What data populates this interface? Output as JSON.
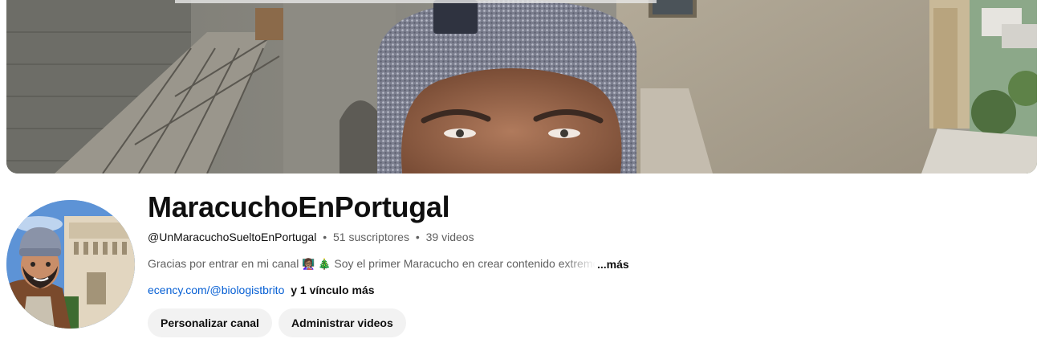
{
  "channel": {
    "name": "MaracuchoEnPortugal",
    "handle": "@UnMaracuchoSueltoEnPortugal",
    "subscribers": "51 suscriptores",
    "videos": "39 videos",
    "separator": "•",
    "description": "Gracias por entrar en mi canal",
    "description_emoji_1": "👩🏽‍🏫",
    "description_emoji_2": "🎄",
    "description_rest": "Soy el primer Maracucho en crear contenido extremo",
    "more_label": "...más",
    "link_text": "ecency.com/@biologistbrito",
    "extra_links": "y 1 vínculo más"
  },
  "actions": {
    "customize_label": "Personalizar canal",
    "manage_label": "Administrar videos"
  },
  "icons": {
    "banner": "channel-banner-photo",
    "avatar": "channel-avatar-illustration"
  },
  "colors": {
    "link": "#065fd4",
    "button_bg": "#f2f2f2",
    "secondary_text": "#606060"
  }
}
